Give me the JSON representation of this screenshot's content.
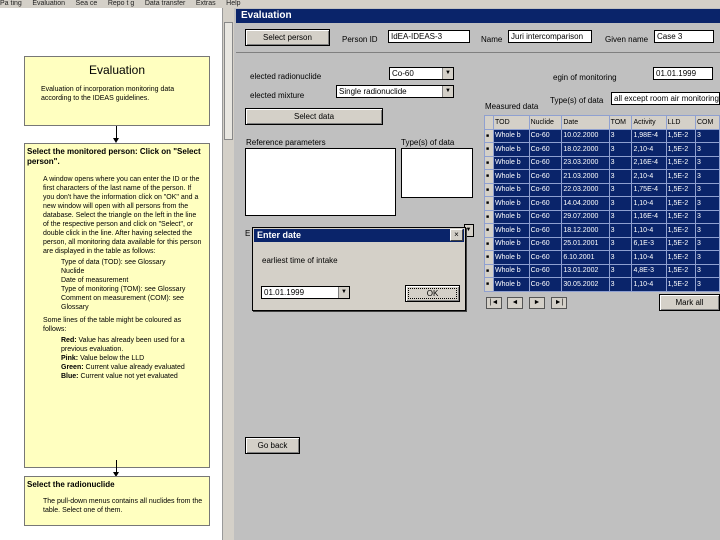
{
  "menu": [
    "Pa ting",
    "Evaluation",
    "Sea ce",
    "Repo t g",
    "Data transfer",
    "Extras",
    "Help"
  ],
  "help": {
    "title": "Evaluation",
    "intro": "Evaluation of incorporation monitoring data according to the IDEAS guidelines.",
    "step1_heading": "Select the monitored person: Click on  \"Select person\".",
    "step1_text": "A window opens where you can enter the ID or the first characters of the last name of the person. If you don't have the information click on \"OK\" and a new window will open with all persons from the database. Select the triangle on the left in the line of the respective person and click on \"Select\", or double click in the line. After having selected the person, all monitoring data available for this person are displayed in the table as follows:",
    "list": [
      "Type of data (TOD): see Glossary",
      "Nuclide",
      "Date of measurement",
      "Type of monitoring (TOM): see Glossary",
      "Comment on measurement (COM): see Glossary"
    ],
    "colors_intro": "Some lines of the table might be coloured as follows:",
    "colors": [
      {
        "key": "Red:",
        "text": "Value has already been used for a previous evaluation."
      },
      {
        "key": "Pink:",
        "text": "Value below the LLD"
      },
      {
        "key": "Green:",
        "text": "Current value already evaluated"
      },
      {
        "key": "Blue:",
        "text": "Current value not yet evaluated"
      }
    ],
    "step2_heading": "Select the radionuclide",
    "step2_text": "The pull-down menus contains all nuclides from the table. Select one of them."
  },
  "window": {
    "title": "Evaluation"
  },
  "person": {
    "select_button": "Select person",
    "id_label": "Person ID",
    "id_value": "IdEA-IDEAS-3",
    "name_label": "Name",
    "name_value": "Juri intercomparison",
    "given_label": "Given name",
    "given_value": "Case 3"
  },
  "form": {
    "nuclide_label": "elected radionuclide",
    "nuclide_value": "Co-60",
    "mixture_label": "elected mixture",
    "mixture_value": "Single radionuclide",
    "select_data": "Select data",
    "begin_label": "egin of monitoring",
    "begin_value": "01.01.1999",
    "measured_label": "Measured data",
    "type_label": "Type(s) of data",
    "type_value": "all except room air monitoring",
    "ref_params_label": "Reference parameters",
    "types_label": "Type(s) of data",
    "go_back": "Go back",
    "mark_all": "Mark all",
    "hidden_label_fragment": "E"
  },
  "table": {
    "headers": [
      "TOD",
      "Nuclide",
      "Date",
      "TOM",
      "Activity",
      "LLD",
      "COM"
    ],
    "rows": [
      [
        "Whole b",
        "Co-60",
        "10.02.2000",
        "3",
        "1,98E-4",
        "1,5E-2",
        "3"
      ],
      [
        "Whole b",
        "Co-60",
        "18.02.2000",
        "3",
        "2,10-4",
        "1,5E-2",
        "3"
      ],
      [
        "Whole b",
        "Co-60",
        "23.03.2000",
        "3",
        "2,16E-4",
        "1,5E-2",
        "3"
      ],
      [
        "Whole b",
        "Co-60",
        "21.03.2000",
        "3",
        "2,10-4",
        "1,5E-2",
        "3"
      ],
      [
        "Whole b",
        "Co-60",
        "22.03.2000",
        "3",
        "1,75E-4",
        "1,5E-2",
        "3"
      ],
      [
        "Whole b",
        "Co-60",
        "14.04.2000",
        "3",
        "1,10-4",
        "1,5E-2",
        "3"
      ],
      [
        "Whole b",
        "Co-60",
        "29.07.2000",
        "3",
        "1,16E-4",
        "1,5E-2",
        "3"
      ],
      [
        "Whole b",
        "Co-60",
        "18.12.2000",
        "3",
        "1,10-4",
        "1,5E-2",
        "3"
      ],
      [
        "Whole b",
        "Co-60",
        "25.01.2001",
        "3",
        "6,1E-3",
        "1,5E-2",
        "3"
      ],
      [
        "Whole b",
        "Co-60",
        "6.10.2001",
        "3",
        "1,10-4",
        "1,5E-2",
        "3"
      ],
      [
        "Whole b",
        "Co-60",
        "13.01.2002",
        "3",
        "4,8E-3",
        "1,5E-2",
        "3"
      ],
      [
        "Whole b",
        "Co-60",
        "30.05.2002",
        "3",
        "1,10-4",
        "1,5E-2",
        "3"
      ]
    ]
  },
  "nav": [
    "|◄",
    "◄",
    "►",
    "►|"
  ],
  "dialog": {
    "title": "Enter date",
    "close": "×",
    "prompt": "earliest time of intake",
    "date_value": "01.01.1999",
    "ok": "OK"
  }
}
